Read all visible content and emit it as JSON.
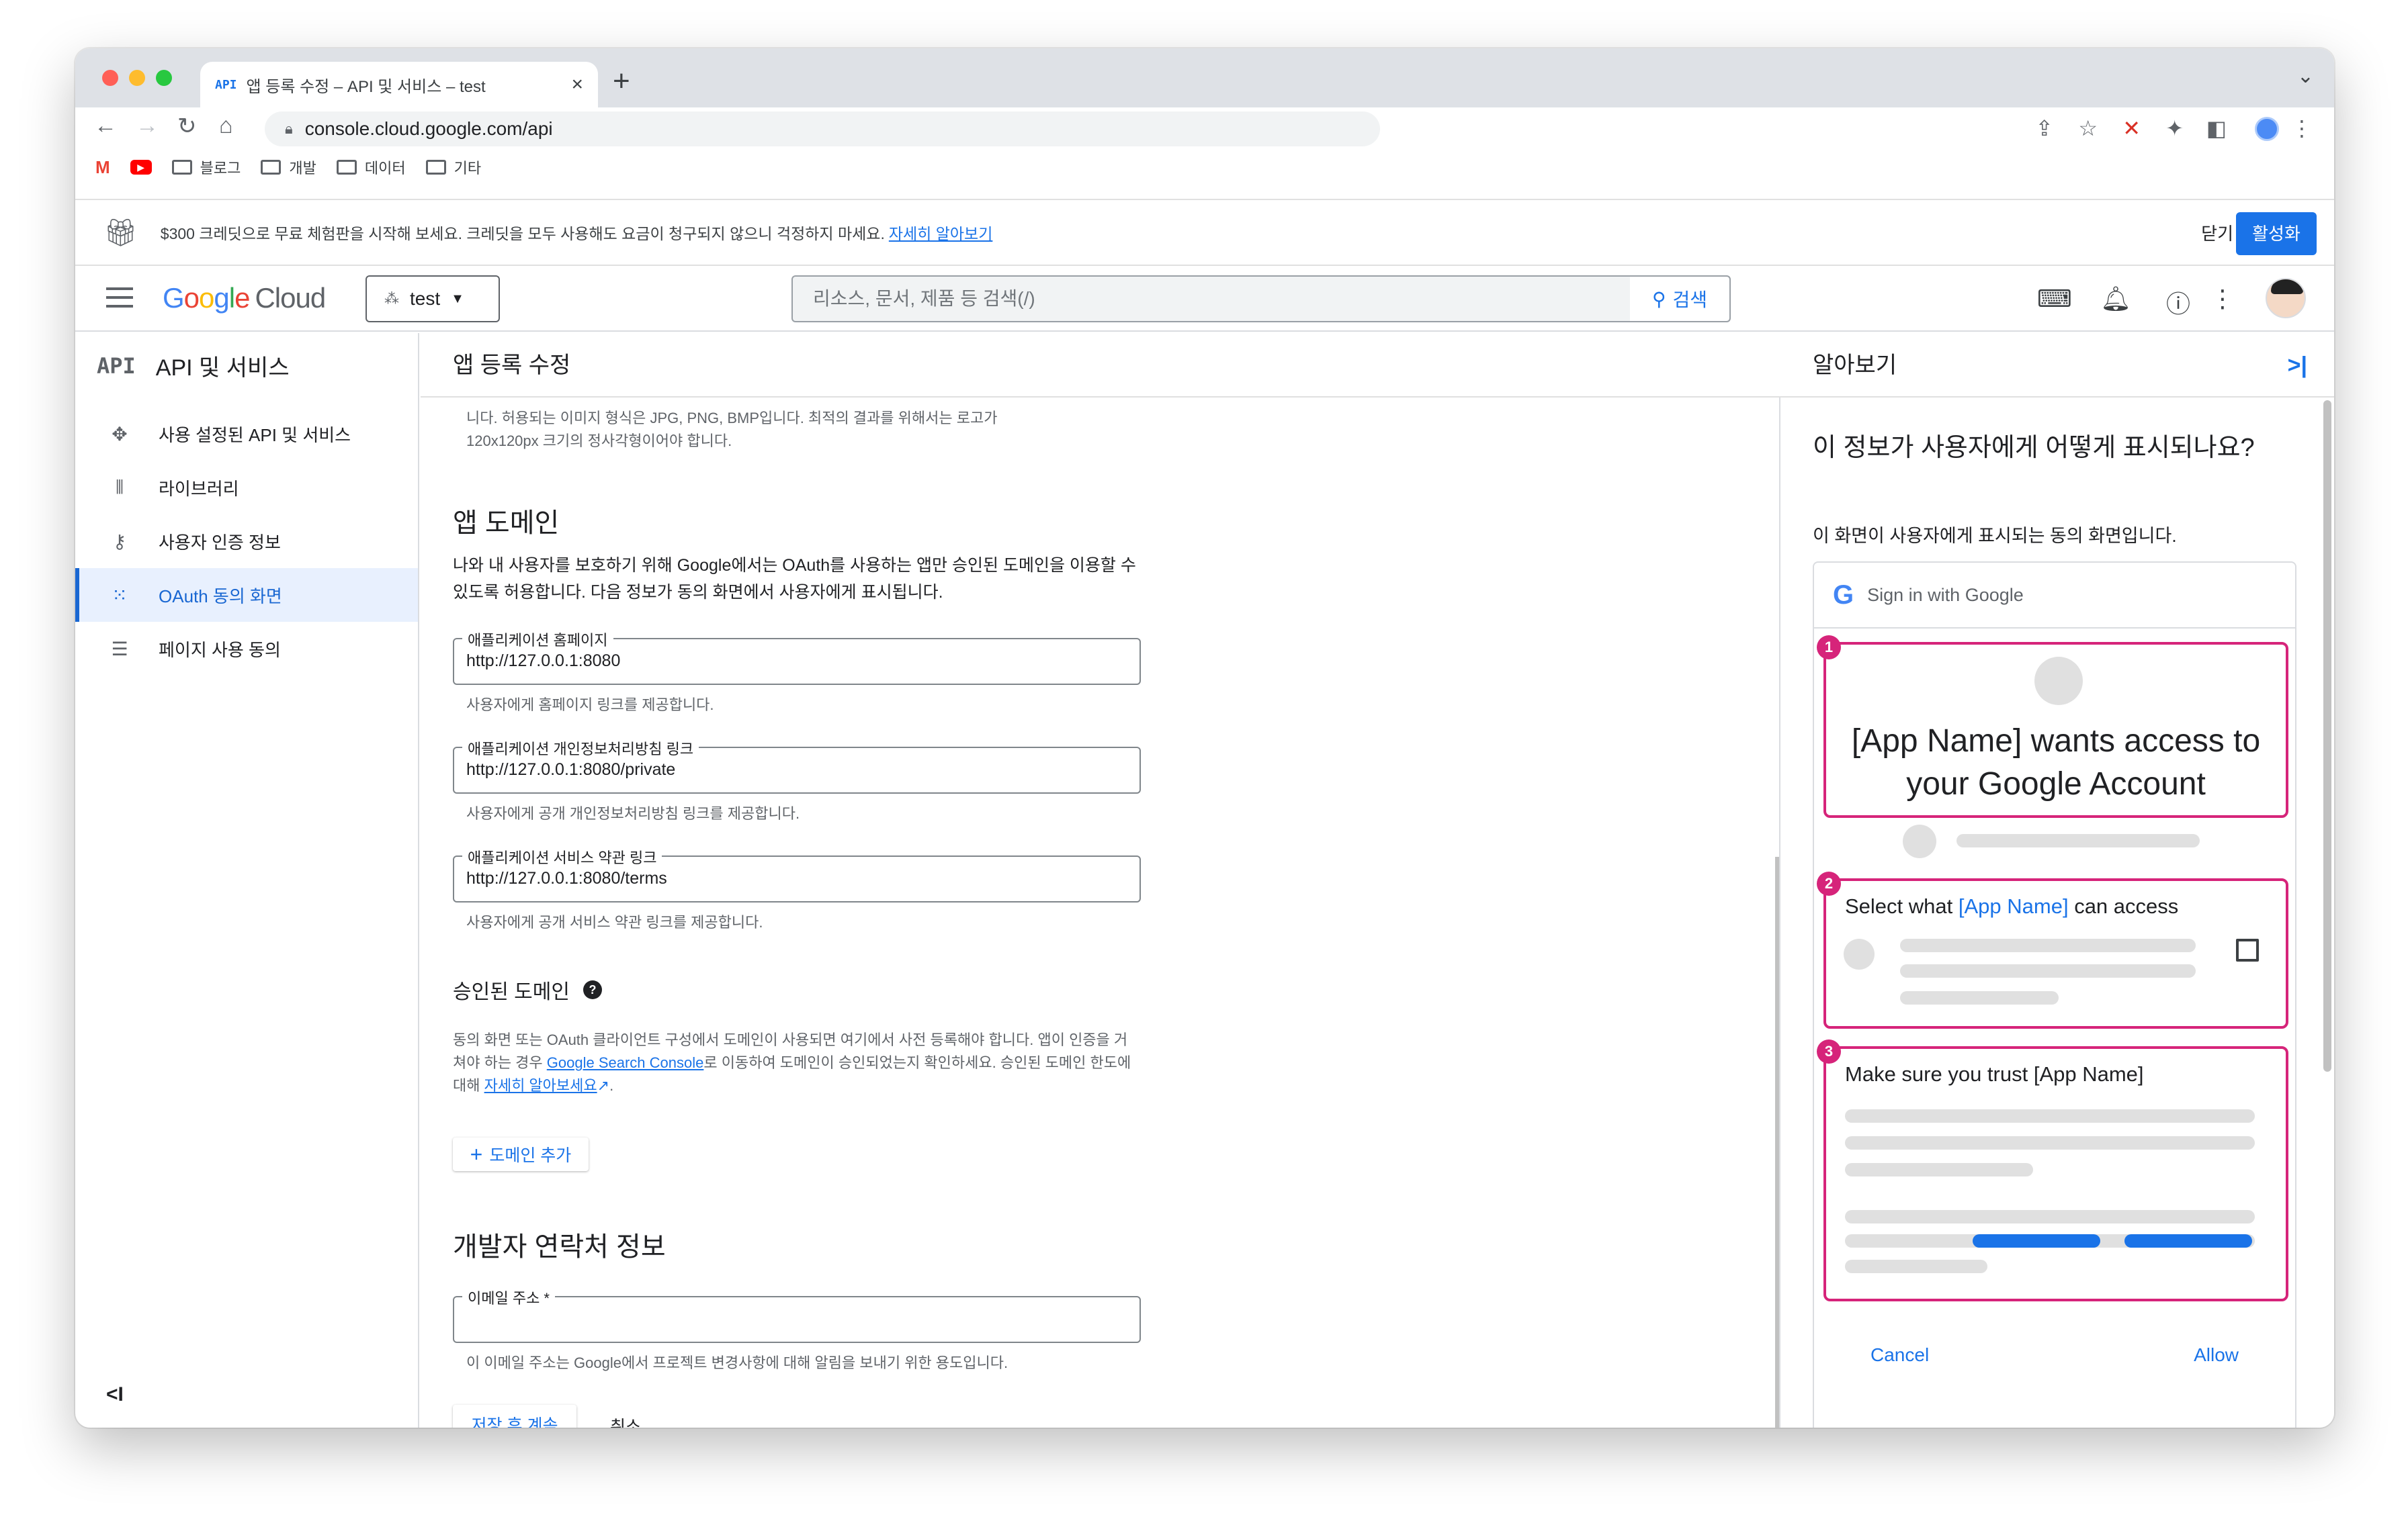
{
  "browser": {
    "tab_favicon": "API",
    "tab_title": "앱 등록 수정 – API 및 서비스 – test",
    "url": "console.cloud.google.com/api",
    "bookmarks": [
      "블로그",
      "개발",
      "데이터",
      "기타"
    ]
  },
  "promo": {
    "text": "$300 크레딧으로 무료 체험판을 시작해 보세요. 크레딧을 모두 사용해도 요금이 청구되지 않으니 걱정하지 마세요.",
    "learn_more": "자세히 알아보기",
    "close_label": "닫기",
    "activate_label": "활성화"
  },
  "header": {
    "logo_google": "Google",
    "logo_cloud": "Cloud",
    "project": "test",
    "search_placeholder": "리소스, 문서, 제품 등 검색(/)",
    "search_button": "검색"
  },
  "leftnav": {
    "logo": "API",
    "title": "API 및 서비스",
    "items": [
      {
        "label": "사용 설정된 API 및 서비스",
        "icon": "diamond-icon",
        "glyph": "✥"
      },
      {
        "label": "라이브러리",
        "icon": "library-icon",
        "glyph": "⦀"
      },
      {
        "label": "사용자 인증 정보",
        "icon": "key-icon",
        "glyph": "⚷"
      },
      {
        "label": "OAuth 동의 화면",
        "icon": "consent-icon",
        "glyph": "⁙"
      },
      {
        "label": "페이지 사용 동의",
        "icon": "settings-list-icon",
        "glyph": "☰"
      }
    ],
    "active_index": 3,
    "collapse_glyph": "<I"
  },
  "main": {
    "title": "앱 등록 수정",
    "logo_hint_partial": "니다. 허용되는 이미지 형식은 JPG, PNG, BMP입니다. 최적의 결과를 위해서는 로고가",
    "logo_hint_partial2": "120x120px 크기의 정사각형이어야 합니다.",
    "app_domain": {
      "heading": "앱 도메인",
      "desc": "나와 내 사용자를 보호하기 위해 Google에서는 OAuth를 사용하는 앱만 승인된 도메인을 이용할 수 있도록 허용합니다. 다음 정보가 동의 화면에서 사용자에게 표시됩니다.",
      "fields": [
        {
          "label": "애플리케이션 홈페이지",
          "value": "http://127.0.0.1:8080",
          "hint": "사용자에게 홈페이지 링크를 제공합니다."
        },
        {
          "label": "애플리케이션 개인정보처리방침 링크",
          "value": "http://127.0.0.1:8080/private",
          "hint": "사용자에게 공개 개인정보처리방침 링크를 제공합니다."
        },
        {
          "label": "애플리케이션 서비스 약관 링크",
          "value": "http://127.0.0.1:8080/terms",
          "hint": "사용자에게 공개 서비스 약관 링크를 제공합니다."
        }
      ]
    },
    "authorized_domains": {
      "heading": "승인된 도메인",
      "desc_1": "동의 화면 또는 OAuth 클라이언트 구성에서 도메인이 사용되면 여기에서 사전 등록해야 합니다. 앱이 인증을 거쳐야 하는 경우 ",
      "link_1": "Google Search Console",
      "desc_2": "로 이동하여 도메인이 승인되었는지 확인하세요. 승인된 도메인 한도에 대해 ",
      "link_2": "자세히 알아보세요",
      "desc_3": ".",
      "add_button": "도메인 추가"
    },
    "developer_contact": {
      "heading": "개발자 연락처 정보",
      "email_label": "이메일 주소 *",
      "email_value": "",
      "hint": "이 이메일 주소는 Google에서 프로젝트 변경사항에 대해 알림을 보내기 위한 용도입니다."
    },
    "save_button": "저장 후 계속",
    "cancel_button": "취소"
  },
  "learn_panel": {
    "title": "알아보기",
    "question": "이 정보가 사용자에게 어떻게 표시되나요?",
    "desc": "이 화면이 사용자에게 표시되는 동의 화면입니다.",
    "mock": {
      "sign_in": "Sign in with Google",
      "box1_badge": "1",
      "box1_text": "[App Name] wants access to your Google Account",
      "box2_badge": "2",
      "box2_prefix": "Select what ",
      "box2_app": "[App Name]",
      "box2_suffix": " can access",
      "box3_badge": "3",
      "box3_text": "Make sure you trust [App Name]",
      "cancel": "Cancel",
      "allow": "Allow"
    }
  },
  "colors": {
    "accent": "#1a73e8",
    "highlight_box": "#d6247a",
    "active_nav_bg": "#e8f0fe"
  }
}
